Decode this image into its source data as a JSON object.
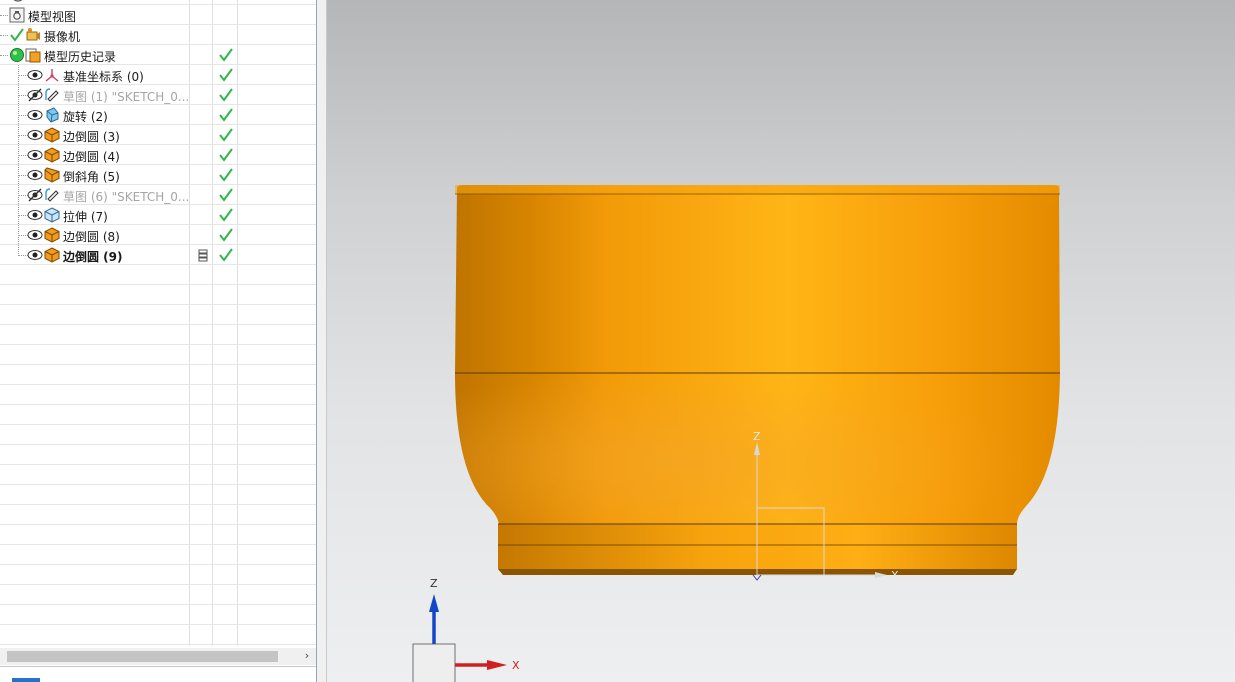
{
  "tree": {
    "rows": [
      {
        "label": "",
        "kind": "partial-top"
      },
      {
        "label": "模型视图",
        "kind": "views"
      },
      {
        "label": "摄像机",
        "kind": "camera"
      },
      {
        "label": "模型历史记录",
        "kind": "history"
      },
      {
        "label": "基准坐标系 (0)",
        "kind": "datum"
      },
      {
        "label": "草图 (1) \"SKETCH_0...",
        "kind": "sketch"
      },
      {
        "label": "旋转 (2)",
        "kind": "revolve"
      },
      {
        "label": "边倒圆 (3)",
        "kind": "blend"
      },
      {
        "label": "边倒圆 (4)",
        "kind": "blend"
      },
      {
        "label": "倒斜角 (5)",
        "kind": "chamfer"
      },
      {
        "label": "草图 (6) \"SKETCH_0...",
        "kind": "sketch"
      },
      {
        "label": "拉伸 (7)",
        "kind": "extrude"
      },
      {
        "label": "边倒圆 (8)",
        "kind": "blend"
      },
      {
        "label": "边倒圆 (9)",
        "kind": "blend"
      }
    ]
  },
  "scrollbar": {
    "right_arrow": "›"
  },
  "viewport": {
    "csys_local": {
      "z": "Z",
      "x": "X"
    },
    "triad": {
      "z": "Z",
      "x": "X"
    }
  },
  "colors": {
    "part_orange": "#f7a10a",
    "check_green": "#2fb84a",
    "selection": "#1f6fd1"
  }
}
